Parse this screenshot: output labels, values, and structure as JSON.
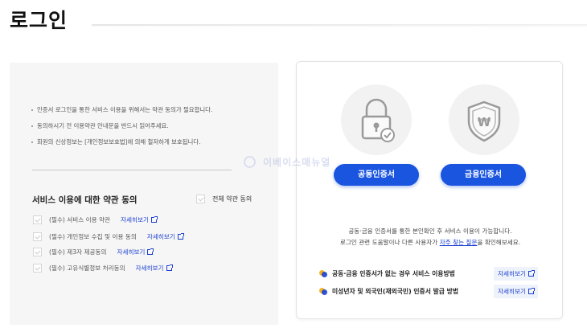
{
  "page": {
    "title": "로그인"
  },
  "notes": [
    "인증서 로그인을 통한 서비스 이용을 위해서는 약관 동의가 필요합니다.",
    "동의하시기 전 이용약관 안내문을 반드시 읽어주세요.",
    "회원의 신상정보는 [개인정보보호법]에 의해 철저하게 보호됩니다."
  ],
  "terms": {
    "title": "서비스 이용에 대한 약관 동의",
    "agree_all": "전체 약관 동의",
    "more_label": "자세히보기",
    "items": [
      {
        "label": "(필수) 서비스 이용 약관"
      },
      {
        "label": "(필수) 개인정보 수집 및 이용 동의"
      },
      {
        "label": "(필수) 제3자 제공동의"
      },
      {
        "label": "(필수) 고유식별정보 처리동의"
      }
    ]
  },
  "auth": {
    "public_cert_button": "공동인증서",
    "financial_cert_button": "금융인증서",
    "info_line1": "공동·금융 인증서를 통한 본인확인 후 서비스 이용이 가능합니다.",
    "info_line2_pre": "로그인 관련 도움말이나 다른 사용자가 ",
    "info_line2_em": "자주 찾는 질문",
    "info_line2_post": "을 확인해보세요.",
    "links": [
      {
        "text": "공동·금융 인증서가 없는 경우 서비스 이용방법",
        "more": "자세히보기"
      },
      {
        "text": "미성년자 및 외국인(재외국민) 인증서 발급 방법",
        "more": "자세히보기"
      }
    ]
  },
  "watermark": {
    "text": "이베이스매뉴얼"
  },
  "colors": {
    "accent": "#1a55e0",
    "link": "#1a3fd2",
    "panel_bg": "#f6f6f6"
  },
  "icons": [
    "lock-check-icon",
    "shield-won-icon",
    "external-link-icon",
    "checkbox-icon"
  ]
}
